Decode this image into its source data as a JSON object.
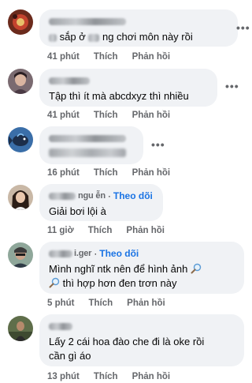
{
  "comments": [
    {
      "text_suffix": "sắp ở",
      "text_rest": "ng chơi môn này rồi",
      "time": "41 phút",
      "like": "Thích",
      "reply": "Phản hồi",
      "more": "•••"
    },
    {
      "text": "Tập thì ít mà abcdxyz thì nhiều",
      "time": "41 phút",
      "like": "Thích",
      "reply": "Phản hồi",
      "more": "•••"
    },
    {
      "time": "16 phút",
      "like": "Thích",
      "reply": "Phản hồi",
      "more": "•••"
    },
    {
      "name_suffix": "ngu ễn",
      "follow_dot": "·",
      "follow": "Theo dõi",
      "text": "Giải bơi lội à",
      "time": "11 giờ",
      "like": "Thích",
      "reply": "Phản hồi"
    },
    {
      "name_suffix": "i.ger",
      "follow_dot": "·",
      "follow": "Theo dõi",
      "text_line1": "Mình nghĩ ntk nên để hình ảnh",
      "text_line2": "thì hợp hơn đen trơn này",
      "time": "5 phút",
      "like": "Thích",
      "reply": "Phản hồi"
    },
    {
      "text_line1": "Lấy 2 cái hoa đào che đi là oke rồi",
      "text_line2": "cần gì áo",
      "time": "13 phút",
      "like": "Thích",
      "reply": "Phản hồi"
    }
  ],
  "colors": {
    "bubble": "#f0f2f5",
    "meta": "#65676b",
    "follow": "#1b74e4",
    "text": "#050505"
  },
  "icons": [
    "avatar",
    "more-options-icon",
    "magnifier-emoji-icon"
  ]
}
